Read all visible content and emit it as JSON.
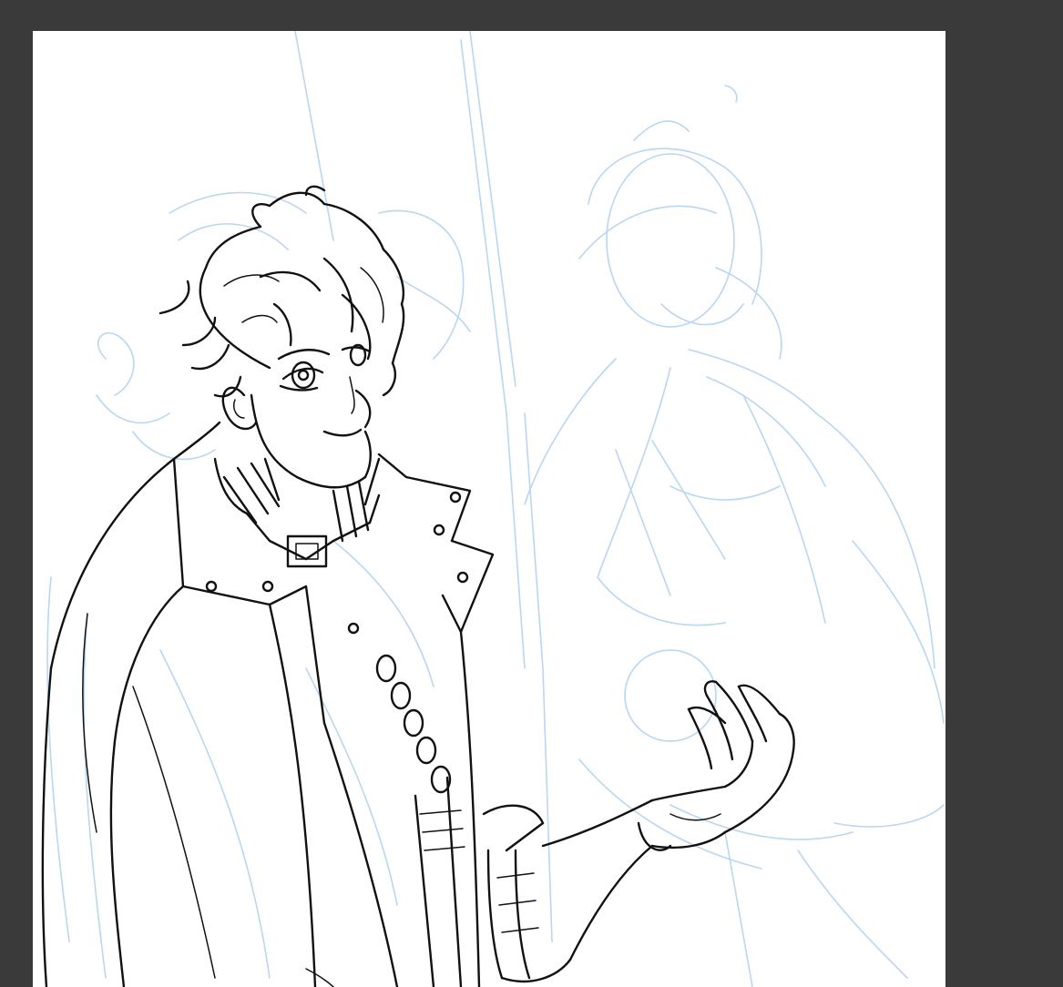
{
  "app": {
    "background_color": "#3a3a3a",
    "canvas_color": "#ffffff"
  },
  "artwork": {
    "sketch_layer_color": "#b9d6f2",
    "ink_layer_color": "#111111"
  }
}
